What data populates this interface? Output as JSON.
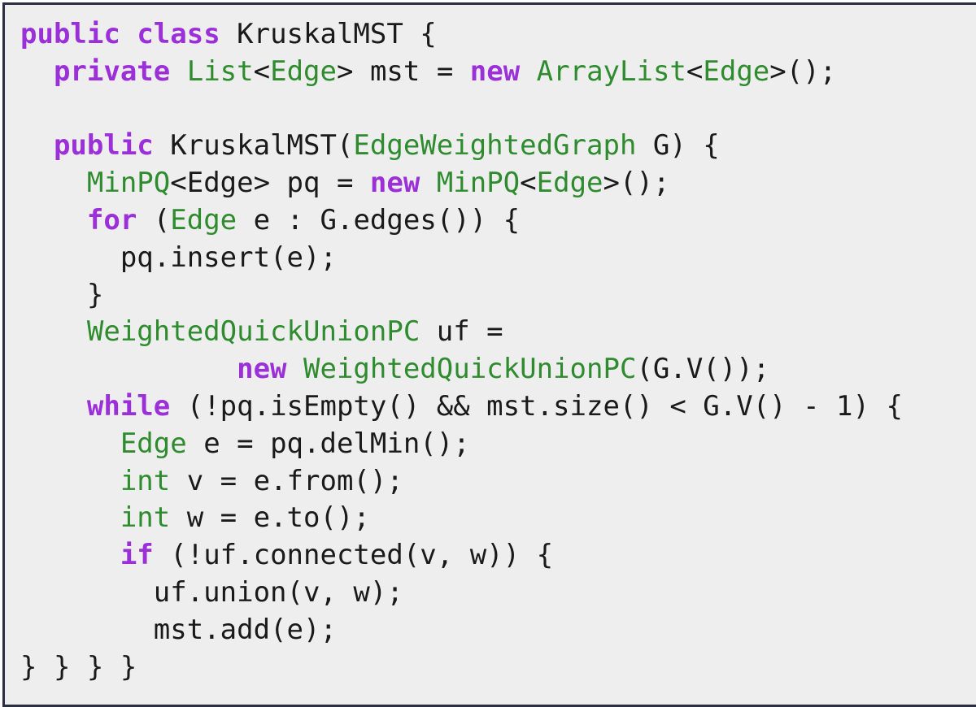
{
  "document": {
    "language": "java",
    "colors": {
      "keyword": "#9b30d9",
      "type": "#2e8b2e",
      "plain": "#1a1a1a",
      "background": "#eeeeee",
      "border": "#2a3042"
    },
    "lines": [
      [
        {
          "k": "kw",
          "t": "public"
        },
        {
          "k": "pl",
          "t": " "
        },
        {
          "k": "kw",
          "t": "class"
        },
        {
          "k": "pl",
          "t": " KruskalMST {"
        }
      ],
      [
        {
          "k": "pl",
          "t": "  "
        },
        {
          "k": "kw",
          "t": "private"
        },
        {
          "k": "pl",
          "t": " "
        },
        {
          "k": "ty",
          "t": "List"
        },
        {
          "k": "pl",
          "t": "<"
        },
        {
          "k": "ty",
          "t": "Edge"
        },
        {
          "k": "pl",
          "t": "> mst = "
        },
        {
          "k": "kw",
          "t": "new"
        },
        {
          "k": "pl",
          "t": " "
        },
        {
          "k": "ty",
          "t": "ArrayList"
        },
        {
          "k": "pl",
          "t": "<"
        },
        {
          "k": "ty",
          "t": "Edge"
        },
        {
          "k": "pl",
          "t": ">();"
        }
      ],
      [],
      [
        {
          "k": "pl",
          "t": "  "
        },
        {
          "k": "kw",
          "t": "public"
        },
        {
          "k": "pl",
          "t": " KruskalMST("
        },
        {
          "k": "ty",
          "t": "EdgeWeightedGraph"
        },
        {
          "k": "pl",
          "t": " G) {"
        }
      ],
      [
        {
          "k": "pl",
          "t": "    "
        },
        {
          "k": "ty",
          "t": "MinPQ"
        },
        {
          "k": "pl",
          "t": "<Edge> pq = "
        },
        {
          "k": "kw",
          "t": "new"
        },
        {
          "k": "pl",
          "t": " "
        },
        {
          "k": "ty",
          "t": "MinPQ"
        },
        {
          "k": "pl",
          "t": "<"
        },
        {
          "k": "ty",
          "t": "Edge"
        },
        {
          "k": "pl",
          "t": ">();"
        }
      ],
      [
        {
          "k": "pl",
          "t": "    "
        },
        {
          "k": "kw",
          "t": "for"
        },
        {
          "k": "pl",
          "t": " ("
        },
        {
          "k": "ty",
          "t": "Edge"
        },
        {
          "k": "pl",
          "t": " e : G.edges()) {"
        }
      ],
      [
        {
          "k": "pl",
          "t": "      pq.insert(e);"
        }
      ],
      [
        {
          "k": "pl",
          "t": "    }"
        }
      ],
      [
        {
          "k": "pl",
          "t": "    "
        },
        {
          "k": "ty",
          "t": "WeightedQuickUnionPC"
        },
        {
          "k": "pl",
          "t": " uf ="
        }
      ],
      [
        {
          "k": "pl",
          "t": "             "
        },
        {
          "k": "kw",
          "t": "new"
        },
        {
          "k": "pl",
          "t": " "
        },
        {
          "k": "ty",
          "t": "WeightedQuickUnionPC"
        },
        {
          "k": "pl",
          "t": "(G.V());"
        }
      ],
      [
        {
          "k": "pl",
          "t": "    "
        },
        {
          "k": "kw",
          "t": "while"
        },
        {
          "k": "pl",
          "t": " (!pq.isEmpty() && mst.size() < G.V() - 1) {"
        }
      ],
      [
        {
          "k": "pl",
          "t": "      "
        },
        {
          "k": "ty",
          "t": "Edge"
        },
        {
          "k": "pl",
          "t": " e = pq.delMin();"
        }
      ],
      [
        {
          "k": "pl",
          "t": "      "
        },
        {
          "k": "ty",
          "t": "int"
        },
        {
          "k": "pl",
          "t": " v = e.from();"
        }
      ],
      [
        {
          "k": "pl",
          "t": "      "
        },
        {
          "k": "ty",
          "t": "int"
        },
        {
          "k": "pl",
          "t": " w = e.to();"
        }
      ],
      [
        {
          "k": "pl",
          "t": "      "
        },
        {
          "k": "kw",
          "t": "if"
        },
        {
          "k": "pl",
          "t": " (!uf.connected(v, w)) {"
        }
      ],
      [
        {
          "k": "pl",
          "t": "        uf.union(v, w);"
        }
      ],
      [
        {
          "k": "pl",
          "t": "        mst.add(e);"
        }
      ],
      [
        {
          "k": "pl",
          "t": "} } } }"
        }
      ]
    ]
  }
}
